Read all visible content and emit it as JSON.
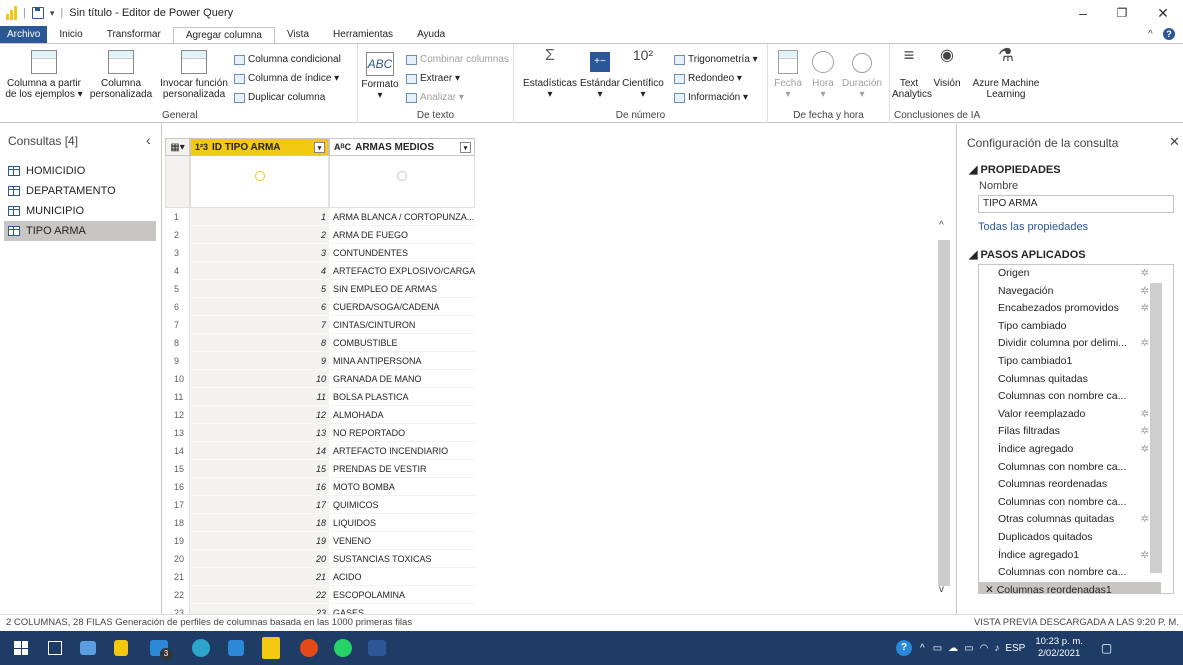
{
  "window": {
    "title": "Sin título - Editor de Power Query"
  },
  "ribbon_tabs": [
    "Archivo",
    "Inicio",
    "Transformar",
    "Agregar columna",
    "Vista",
    "Herramientas",
    "Ayuda"
  ],
  "ribbon": {
    "general": {
      "label": "General",
      "col_from_examples": "Columna a partir de los ejemplos ▾",
      "custom_col": "Columna personalizada",
      "invoke_fn": "Invocar función personalizada",
      "conditional": "Columna condicional",
      "index": "Columna de índice ▾",
      "duplicate": "Duplicar columna"
    },
    "texto": {
      "label": "De texto",
      "format": "Formato",
      "combine": "Combinar columnas",
      "extract": "Extraer ▾",
      "analyze": "Analizar ▾"
    },
    "numero": {
      "label": "De número",
      "stats": "Estadísticas",
      "standard": "Estándar",
      "scientific": "Científico",
      "trig": "Trigonometría ▾",
      "round": "Redondeo ▾",
      "info": "Información ▾"
    },
    "fecha": {
      "label": "De fecha y hora",
      "date": "Fecha",
      "time": "Hora",
      "duration": "Duración"
    },
    "ia": {
      "label": "Conclusiones de IA",
      "text_analytics": "Text Analytics",
      "vision": "Visión",
      "azure_ml": "Azure Machine Learning"
    }
  },
  "queries": {
    "header": "Consultas [4]",
    "items": [
      "HOMICIDIO",
      "DEPARTAMENTO",
      "MUNICIPIO",
      "TIPO ARMA"
    ],
    "selected": "TIPO ARMA"
  },
  "grid": {
    "columns": [
      {
        "type": "1²3",
        "name": "ID TIPO ARMA"
      },
      {
        "type": "AᴮC",
        "name": "ARMAS MEDIOS"
      }
    ],
    "rows": [
      [
        1,
        "ARMA BLANCA / CORTOPUNZA..."
      ],
      [
        2,
        "ARMA DE FUEGO"
      ],
      [
        3,
        "CONTUNDENTES"
      ],
      [
        4,
        "ARTEFACTO EXPLOSIVO/CARGA..."
      ],
      [
        5,
        "SIN EMPLEO DE ARMAS"
      ],
      [
        6,
        "CUERDA/SOGA/CADENA"
      ],
      [
        7,
        "CINTAS/CINTURON"
      ],
      [
        8,
        "COMBUSTIBLE"
      ],
      [
        9,
        "MINA ANTIPERSONA"
      ],
      [
        10,
        "GRANADA DE MANO"
      ],
      [
        11,
        "BOLSA PLASTICA"
      ],
      [
        12,
        "ALMOHADA"
      ],
      [
        13,
        "NO REPORTADO"
      ],
      [
        14,
        "ARTEFACTO INCENDIARIO"
      ],
      [
        15,
        "PRENDAS DE VESTIR"
      ],
      [
        16,
        "MOTO BOMBA"
      ],
      [
        17,
        "QUIMICOS"
      ],
      [
        18,
        "LIQUIDOS"
      ],
      [
        19,
        "VENENO"
      ],
      [
        20,
        "SUSTANCIAS TOXICAS"
      ],
      [
        21,
        "ACIDO"
      ],
      [
        22,
        "ESCOPOLAMINA"
      ],
      [
        23,
        "GASES"
      ]
    ]
  },
  "settings": {
    "title": "Configuración de la consulta",
    "props_header": "◢ PROPIEDADES",
    "name_label": "Nombre",
    "name_value": "TIPO ARMA",
    "all_props": "Todas las propiedades",
    "steps_header": "◢ PASOS APLICADOS",
    "steps": [
      {
        "label": "Origen",
        "gear": true
      },
      {
        "label": "Navegación",
        "gear": true
      },
      {
        "label": "Encabezados promovidos",
        "gear": true
      },
      {
        "label": "Tipo cambiado",
        "gear": false
      },
      {
        "label": "Dividir columna por delimi...",
        "gear": true
      },
      {
        "label": "Tipo cambiado1",
        "gear": false
      },
      {
        "label": "Columnas quitadas",
        "gear": false
      },
      {
        "label": "Columnas con nombre ca...",
        "gear": false
      },
      {
        "label": "Valor reemplazado",
        "gear": true
      },
      {
        "label": "Filas filtradas",
        "gear": true
      },
      {
        "label": "Índice agregado",
        "gear": true
      },
      {
        "label": "Columnas con nombre ca...",
        "gear": false
      },
      {
        "label": "Columnas reordenadas",
        "gear": false
      },
      {
        "label": "Columnas con nombre ca...",
        "gear": false
      },
      {
        "label": "Otras columnas quitadas",
        "gear": true
      },
      {
        "label": "Duplicados quitados",
        "gear": false
      },
      {
        "label": "Índice agregado1",
        "gear": true
      },
      {
        "label": "Columnas con nombre ca...",
        "gear": false
      },
      {
        "label": "Columnas reordenadas1",
        "gear": false,
        "selected": true
      }
    ]
  },
  "status": {
    "left": "2 COLUMNAS, 28 FILAS   Generación de perfiles de columnas basada en las 1000 primeras filas",
    "right": "VISTA PREVIA DESCARGADA A LAS 9:20 P. M."
  },
  "taskbar": {
    "time": "10:23 p. m.",
    "date": "2/02/2021",
    "lang": "ESP",
    "mail_badge": "3"
  },
  "colors": {
    "accent": "#2b5797",
    "column_selected": "#f2c811",
    "taskbar": "#1f3c66"
  }
}
